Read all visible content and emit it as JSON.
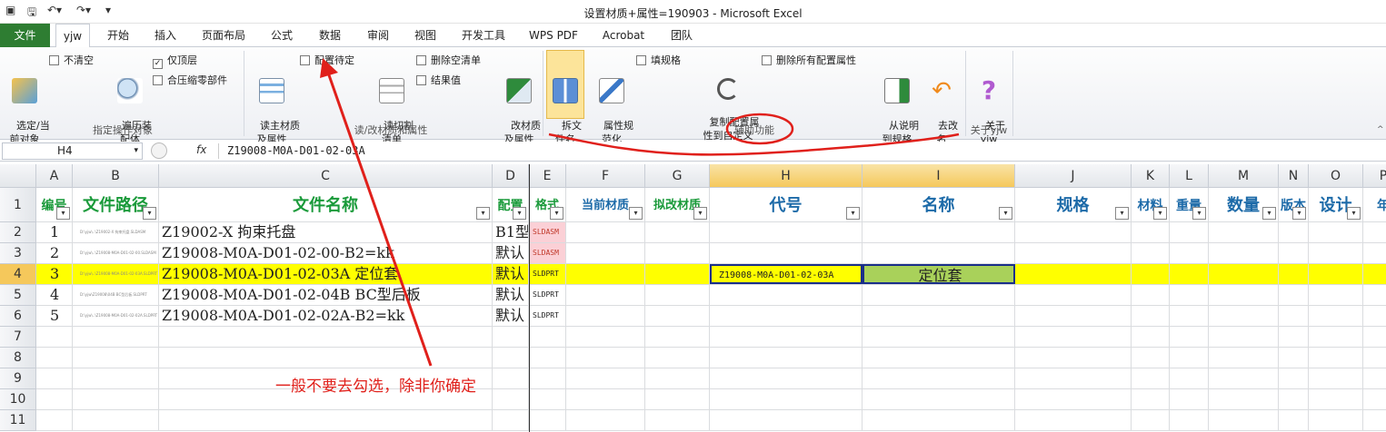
{
  "window": {
    "title": "设置材质+属性=190903  -  Microsoft Excel"
  },
  "tabs": [
    "文件",
    "yjw",
    "开始",
    "插入",
    "页面布局",
    "公式",
    "数据",
    "审阅",
    "视图",
    "开发工具",
    "WPS PDF",
    "Acrobat",
    "团队"
  ],
  "ribbon": {
    "btn_select": "选定/当\n前对象",
    "cb_noclear": "不清空",
    "btn_traverse": "遍历装\n配体",
    "cb_toplevel": "仅顶层",
    "cb_compress": "合压缩零部件",
    "grp1": "指定操作对象",
    "btn_readmain": "读主材质\n及属性",
    "cb_config_pending": "配置待定",
    "btn_readcut": "读切割\n清单",
    "cb_delempty": "删除空清单",
    "cb_result": "结果值",
    "grp2": "读/改材质和属性",
    "btn_changemat": "改材质\n及属性",
    "btn_splitname": "拆文\n件名",
    "btn_normalize": "属性规\n范化",
    "cb_fillspec": "填规格",
    "btn_copyconfig": "复制配置属\n性到自定义",
    "cb_delallconfig": "删除所有配置属性",
    "grp3": "辅助功能",
    "btn_fromdesc": "从说明\n到规格",
    "btn_removechange": "去改\n名",
    "btn_about": "关于\nyjw",
    "grp4": "关于yjw"
  },
  "formula": {
    "namebox": "H4",
    "fx": "fx",
    "value": "Z19008-M0A-D01-02-03A"
  },
  "columns": [
    "A",
    "B",
    "C",
    "D",
    "E",
    "F",
    "G",
    "H",
    "I",
    "J",
    "K",
    "L",
    "M",
    "N",
    "O",
    "P"
  ],
  "header_row": {
    "A": "编号",
    "B": "文件路径",
    "C": "文件名称",
    "D": "配置",
    "E": "格式",
    "F": "当前材质",
    "G": "拟改材质",
    "H": "代号",
    "I": "名称",
    "J": "规格",
    "K": "材料",
    "L": "重量",
    "M": "数量",
    "N": "版本",
    "O": "设计",
    "P": "年"
  },
  "rows": [
    {
      "n": "2",
      "A": "1",
      "B": "D:\\yjw\\..\\Z19002-X 拘束托盘.SLDASM",
      "C": "Z19002-X 拘束托盘",
      "D": "B1型",
      "E": "SLDASM",
      "H": "",
      "I": ""
    },
    {
      "n": "3",
      "A": "2",
      "B": "D:\\yjw\\..\\Z19008-M0A-D01-02-00.SLDASM",
      "C": "Z19008-M0A-D01-02-00-B2=kk",
      "D": "默认",
      "E": "SLDASM",
      "H": "",
      "I": ""
    },
    {
      "n": "4",
      "A": "3",
      "B": "D:\\yjw\\..\\Z19008-M0A-D01-02-03A.SLDPRT",
      "C": "Z19008-M0A-D01-02-03A 定位套",
      "D": "默认",
      "E": "SLDPRT",
      "H": "Z19008-M0A-D01-02-03A",
      "I": "定位套"
    },
    {
      "n": "5",
      "A": "4",
      "B": "D:\\yjw\\Z19008\\04B BC型后板.SLDPRT",
      "C": "Z19008-M0A-D01-02-04B BC型后板",
      "D": "默认",
      "E": "SLDPRT",
      "H": "",
      "I": ""
    },
    {
      "n": "6",
      "A": "5",
      "B": "D:\\yjw\\..\\Z19008-M0A-D01-02-02A.SLDPRT",
      "C": "Z19008-M0A-D01-02-02A-B2=kk",
      "D": "默认",
      "E": "SLDPRT",
      "H": "",
      "I": ""
    }
  ],
  "empty_rows": [
    "7",
    "8",
    "9",
    "10",
    "11"
  ],
  "row1_num": "1",
  "annotation": "一般不要去勾选，除非你确定",
  "colors": {
    "file_tab": "#2e7d32",
    "highlight_row": "#ffff00",
    "name_cell": "#a9d15a",
    "annotation": "#e0201b",
    "header_green": "#1a9a3a",
    "header_blue": "#1c6aa8"
  }
}
